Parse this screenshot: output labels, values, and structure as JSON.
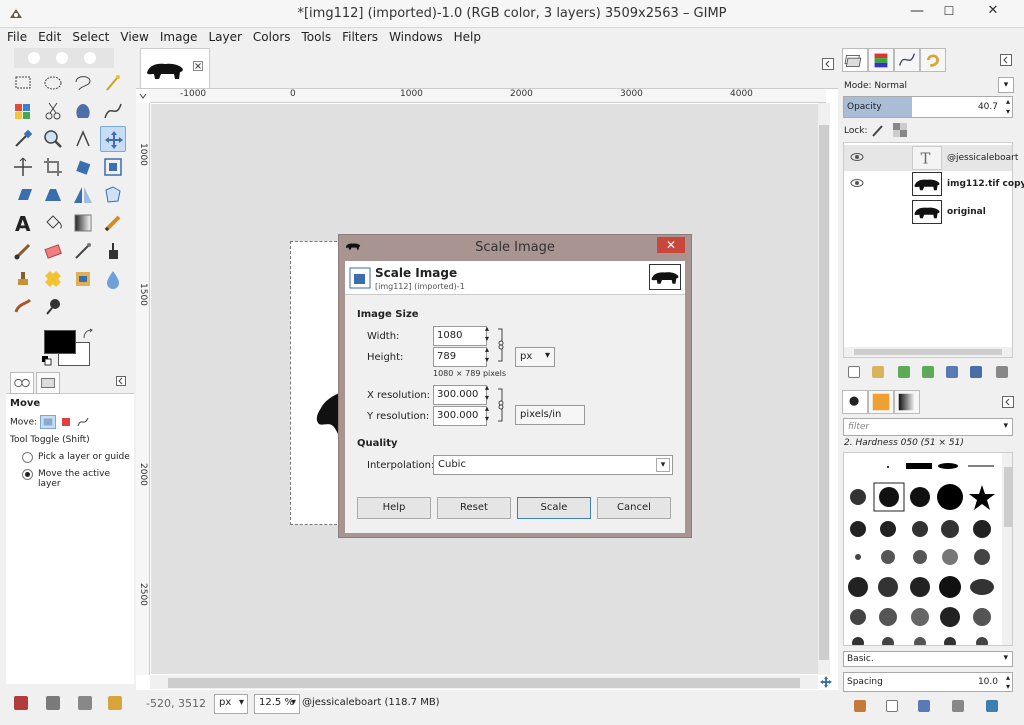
{
  "window": {
    "title": "*[img112] (imported)-1.0 (RGB color, 3 layers) 3509x2563 – GIMP",
    "minimize": "—",
    "maximize": "☐",
    "close": "✕"
  },
  "menu": [
    "File",
    "Edit",
    "Select",
    "View",
    "Image",
    "Layer",
    "Colors",
    "Tools",
    "Filters",
    "Windows",
    "Help"
  ],
  "rulers": {
    "horizontal": [
      "-1000",
      "0",
      "1000",
      "2000",
      "3000",
      "4000"
    ],
    "vertical": [
      "1000",
      "1500",
      "2000",
      "2500"
    ]
  },
  "tool_options": {
    "title": "Move",
    "move_label": "Move:",
    "toggle_label": "Tool Toggle  (Shift)",
    "options": [
      {
        "label": "Pick a layer or guide",
        "selected": false
      },
      {
        "label": "Move the active layer",
        "selected": true
      }
    ]
  },
  "status": {
    "coords": "-520, 3512",
    "unit": "px",
    "zoom": "12.5 %",
    "layer_info": "@jessicaleboart (118.7 MB)"
  },
  "layers_panel": {
    "mode_label": "Mode: Normal",
    "opacity_label": "Opacity",
    "opacity_value": "40.7",
    "opacity_fraction": 0.407,
    "lock_label": "Lock:",
    "layers": [
      {
        "name": "@jessicaleboart",
        "type": "text",
        "selected": true,
        "visible": true
      },
      {
        "name": "img112.tif copy",
        "type": "image",
        "selected": false,
        "visible": true
      },
      {
        "name": "original",
        "type": "image",
        "selected": false,
        "visible": false
      }
    ]
  },
  "brushes_panel": {
    "filter_placeholder": "filter",
    "brush_name": "2. Hardness 050 (51 × 51)",
    "preset": "Basic.",
    "spacing_label": "Spacing",
    "spacing_value": "10.0"
  },
  "dialog": {
    "window_title": "Scale Image",
    "header_title": "Scale Image",
    "header_subtitle": "[img112] (imported)-1",
    "section_size": "Image Size",
    "width_label": "Width:",
    "width_value": "1080",
    "height_label": "Height:",
    "height_value": "789",
    "size_unit": "px",
    "pixel_summary": "1080 × 789 pixels",
    "xres_label": "X resolution:",
    "xres_value": "300.000",
    "yres_label": "Y resolution:",
    "yres_value": "300.000",
    "res_unit": "pixels/in",
    "section_quality": "Quality",
    "interp_label": "Interpolation:",
    "interp_value": "Cubic",
    "buttons": {
      "help": "Help",
      "reset": "Reset",
      "scale": "Scale",
      "cancel": "Cancel"
    }
  }
}
